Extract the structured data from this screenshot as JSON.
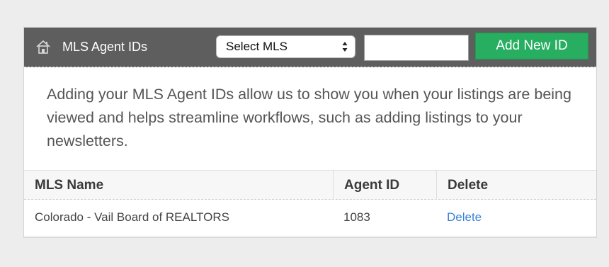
{
  "header": {
    "title": "MLS Agent IDs",
    "icon": "home-icon",
    "mls_select": {
      "selected": "Select MLS"
    },
    "agent_id_input": {
      "value": "",
      "placeholder": ""
    },
    "add_button_label": "Add New ID",
    "colors": {
      "header_bg": "#5e5e5e",
      "add_button_bg": "#27ae60",
      "link": "#3b82d6"
    }
  },
  "intro": {
    "text": "Adding your MLS Agent IDs allow us to show you when your listings are being viewed and helps streamline workflows, such as adding listings to your newsletters."
  },
  "table": {
    "columns": [
      "MLS Name",
      "Agent ID",
      "Delete"
    ],
    "rows": [
      {
        "mls_name": "Colorado - Vail Board of REALTORS",
        "agent_id": "1083",
        "delete_label": "Delete"
      }
    ]
  }
}
